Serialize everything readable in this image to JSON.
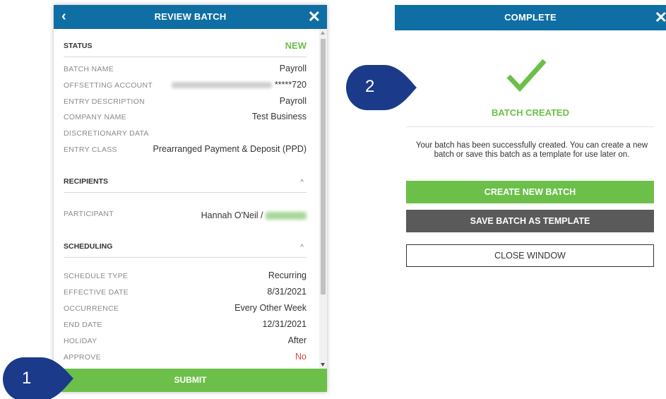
{
  "review": {
    "back_icon": "‹",
    "title": "REVIEW BATCH",
    "close_icon": "✕",
    "status_label": "STATUS",
    "status_value": "NEW",
    "fields": [
      {
        "label": "BATCH NAME",
        "value": "Payroll"
      },
      {
        "label": "OFFSETTING ACCOUNT",
        "value": "*****720"
      },
      {
        "label": "ENTRY DESCRIPTION",
        "value": "Payroll"
      },
      {
        "label": "COMPANY NAME",
        "value": "Test Business"
      },
      {
        "label": "DISCRETIONARY DATA",
        "value": ""
      },
      {
        "label": "ENTRY CLASS",
        "value": "Prearranged Payment & Deposit (PPD)"
      }
    ],
    "recipients_title": "RECIPIENTS",
    "participant_label": "PARTICIPANT",
    "participant_value": "Hannah O'Neil /",
    "scheduling_title": "SCHEDULING",
    "schedule": [
      {
        "label": "SCHEDULE TYPE",
        "value": "Recurring"
      },
      {
        "label": "EFFECTIVE DATE",
        "value": "8/31/2021"
      },
      {
        "label": "OCCURRENCE",
        "value": "Every Other Week"
      },
      {
        "label": "END DATE",
        "value": "12/31/2021"
      },
      {
        "label": "HOLIDAY",
        "value": "After"
      },
      {
        "label": "APPROVE",
        "value": "No"
      }
    ],
    "collapse_icon": "^",
    "submit_label": "SUBMIT"
  },
  "complete": {
    "title": "COMPLETE",
    "close_icon": "✕",
    "success_icon": "checkmark-icon",
    "heading": "BATCH CREATED",
    "message": "Your batch has been successfully created. You can create a new batch or save this batch as a template for use later on.",
    "create_new_label": "CREATE NEW BATCH",
    "save_template_label": "SAVE BATCH AS TEMPLATE",
    "close_window_label": "CLOSE WINDOW"
  },
  "callouts": {
    "step1": "1",
    "step2": "2"
  },
  "colors": {
    "header_blue": "#0f6ea4",
    "green": "#6cc04a",
    "dark_button": "#5a5a5a",
    "callout_navy": "#1b3a8a",
    "red": "#e0483d"
  }
}
